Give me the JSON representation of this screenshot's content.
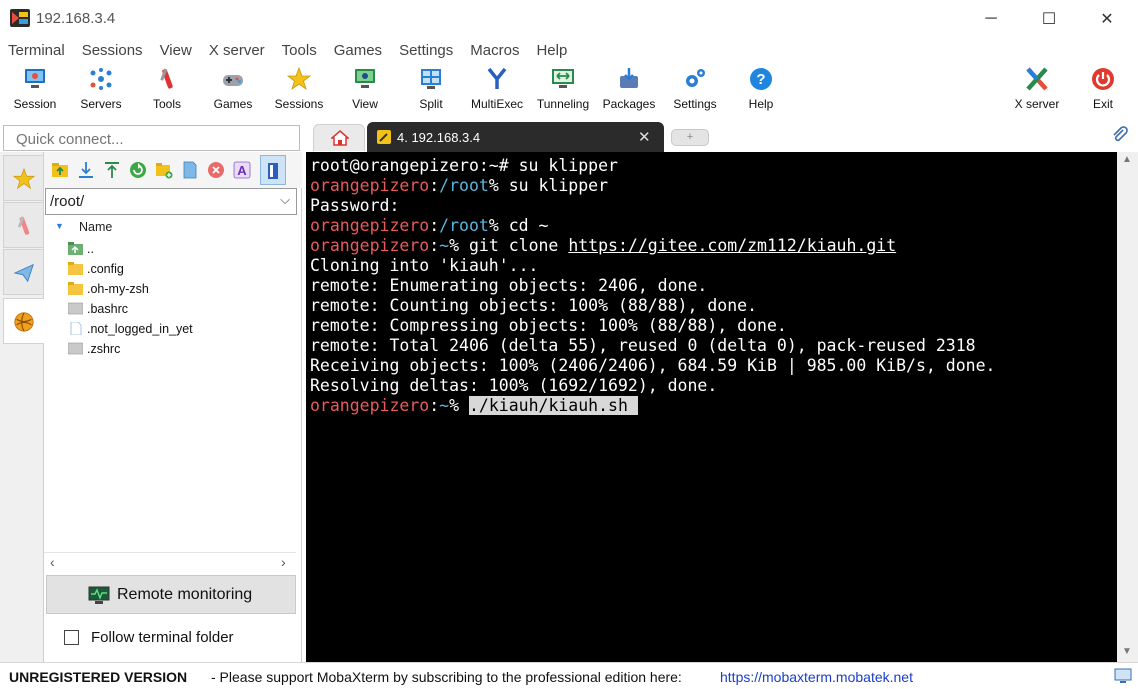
{
  "window": {
    "title": "192.168.3.4"
  },
  "menu": [
    "Terminal",
    "Sessions",
    "View",
    "X server",
    "Tools",
    "Games",
    "Settings",
    "Macros",
    "Help"
  ],
  "toolbar": [
    {
      "label": "Session",
      "icon": "monitor-session-icon"
    },
    {
      "label": "Servers",
      "icon": "servers-network-icon"
    },
    {
      "label": "Tools",
      "icon": "tools-icon"
    },
    {
      "label": "Games",
      "icon": "gamepad-icon"
    },
    {
      "label": "Sessions",
      "icon": "star-sessions-icon"
    },
    {
      "label": "View",
      "icon": "view-icon"
    },
    {
      "label": "Split",
      "icon": "split-icon"
    },
    {
      "label": "MultiExec",
      "icon": "multiexec-icon"
    },
    {
      "label": "Tunneling",
      "icon": "tunneling-icon"
    },
    {
      "label": "Packages",
      "icon": "packages-icon"
    },
    {
      "label": "Settings",
      "icon": "settings-gears-icon"
    },
    {
      "label": "Help",
      "icon": "help-icon"
    }
  ],
  "toolbar_right": [
    {
      "label": "X server",
      "icon": "x-server-icon"
    },
    {
      "label": "Exit",
      "icon": "power-icon"
    }
  ],
  "quick_connect": {
    "placeholder": "Quick connect..."
  },
  "tabs": {
    "session_label": "4. 192.168.3.4",
    "close": "✕",
    "new": "+"
  },
  "file_panel": {
    "path": "/root/",
    "header": "Name",
    "files": [
      {
        "name": "..",
        "kind": "parent"
      },
      {
        "name": ".config",
        "kind": "folder"
      },
      {
        "name": ".oh-my-zsh",
        "kind": "folder"
      },
      {
        "name": ".bashrc",
        "kind": "file"
      },
      {
        "name": ".not_logged_in_yet",
        "kind": "doc"
      },
      {
        "name": ".zshrc",
        "kind": "file"
      }
    ],
    "remote_monitoring": "Remote monitoring",
    "follow_terminal_folder": "Follow terminal folder"
  },
  "terminal": {
    "lines": [
      [
        {
          "t": "root@orangepizero:~# su klipper",
          "c": ""
        }
      ],
      [
        {
          "t": "orangepizero",
          "c": "c-host"
        },
        {
          "t": ":",
          "c": ""
        },
        {
          "t": "/root",
          "c": "c-path"
        },
        {
          "t": "% su klipper",
          "c": ""
        }
      ],
      [
        {
          "t": "Password:",
          "c": ""
        }
      ],
      [
        {
          "t": "orangepizero",
          "c": "c-host"
        },
        {
          "t": ":",
          "c": ""
        },
        {
          "t": "/root",
          "c": "c-path"
        },
        {
          "t": "% cd ~",
          "c": ""
        }
      ],
      [
        {
          "t": "orangepizero",
          "c": "c-host"
        },
        {
          "t": ":",
          "c": ""
        },
        {
          "t": "~",
          "c": "c-path"
        },
        {
          "t": "% git clone ",
          "c": ""
        },
        {
          "t": "https://gitee.com/zm112/kiauh.git",
          "c": "c-link"
        }
      ],
      [
        {
          "t": "Cloning into 'kiauh'...",
          "c": ""
        }
      ],
      [
        {
          "t": "remote: Enumerating objects: 2406, done.",
          "c": ""
        }
      ],
      [
        {
          "t": "remote: Counting objects: 100% (88/88), done.",
          "c": ""
        }
      ],
      [
        {
          "t": "remote: Compressing objects: 100% (88/88), done.",
          "c": ""
        }
      ],
      [
        {
          "t": "remote: Total 2406 (delta 55), reused 0 (delta 0), pack-reused 2318",
          "c": ""
        }
      ],
      [
        {
          "t": "Receiving objects: 100% (2406/2406), 684.59 KiB | 985.00 KiB/s, done.",
          "c": ""
        }
      ],
      [
        {
          "t": "Resolving deltas: 100% (1692/1692), done.",
          "c": ""
        }
      ],
      [
        {
          "t": "orangepizero",
          "c": "c-host"
        },
        {
          "t": ":",
          "c": ""
        },
        {
          "t": "~",
          "c": "c-path"
        },
        {
          "t": "% ",
          "c": ""
        },
        {
          "t": "./kiauh/kiauh.sh ",
          "c": "c-cursor"
        }
      ]
    ]
  },
  "status": {
    "unregistered": "UNREGISTERED VERSION",
    "message": " -  Please support MobaXterm by subscribing to the professional edition here:",
    "link": "https://mobaxterm.mobatek.net"
  },
  "colors": {
    "terminal_bg": "#000000",
    "host": "#e8595a",
    "path": "#58b6df",
    "link": "#1a3ec8"
  }
}
